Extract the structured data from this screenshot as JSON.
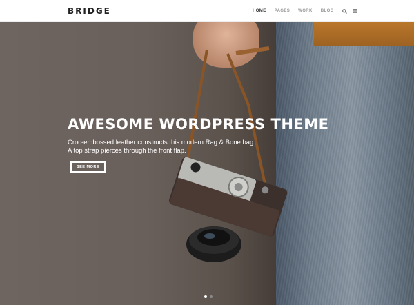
{
  "brand": {
    "logo_text": "BRIDGE"
  },
  "nav": {
    "items": [
      {
        "label": "HOME",
        "active": true
      },
      {
        "label": "PAGES",
        "active": false
      },
      {
        "label": "WORK",
        "active": false
      },
      {
        "label": "BLOG",
        "active": false
      }
    ],
    "search_icon": "search-icon",
    "menu_icon": "hamburger-menu-icon"
  },
  "hero": {
    "title": "AWESOME WORDPRESS THEME",
    "line1": "Croc-embossed leather constructs this modern Rag & Bone bag.",
    "line2": "A top strap pierces through the front flap.",
    "button_label": "SEE MORE",
    "slides": [
      {
        "active": true
      },
      {
        "active": false
      }
    ]
  },
  "colors": {
    "accent": "#ffffff",
    "header_bg": "#ffffff",
    "nav_text": "#999999",
    "nav_active": "#333333",
    "dot_active": "#ffffff",
    "dot_inactive": "#8a8a8a"
  }
}
